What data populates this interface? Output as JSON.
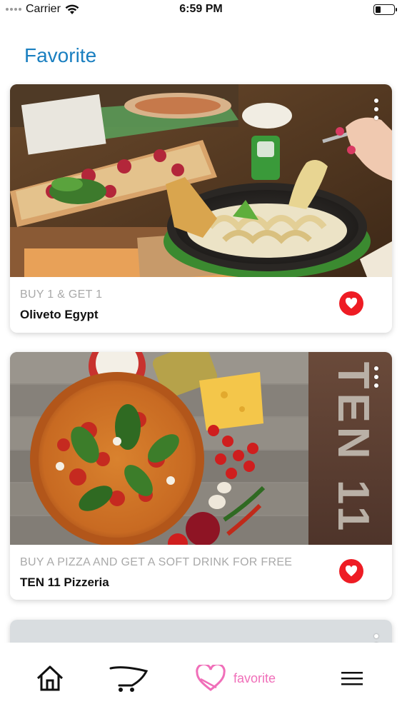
{
  "status_bar": {
    "carrier": "Carrier",
    "time": "6:59 PM",
    "battery_level": 0.3
  },
  "page": {
    "title": "Favorite"
  },
  "favorites": [
    {
      "promo": "BUY 1 & GET 1",
      "name": "Oliveto Egypt"
    },
    {
      "promo": "BUY A PIZZA AND GET A SOFT DRINK FOR FREE",
      "name": "TEN 11 Pizzeria",
      "image_sign_text": "TEN 11"
    }
  ],
  "tab_bar": {
    "items": [
      {
        "icon": "home-icon"
      },
      {
        "icon": "cart-icon"
      },
      {
        "icon": "heart-outline-icon",
        "label": "favorite",
        "active": true
      },
      {
        "icon": "menu-icon"
      }
    ],
    "active_color": "#f06fb9"
  },
  "colors": {
    "title": "#1a7fc0",
    "favorite_button": "#ee1c24",
    "promo_text": "#a9a9a9"
  }
}
